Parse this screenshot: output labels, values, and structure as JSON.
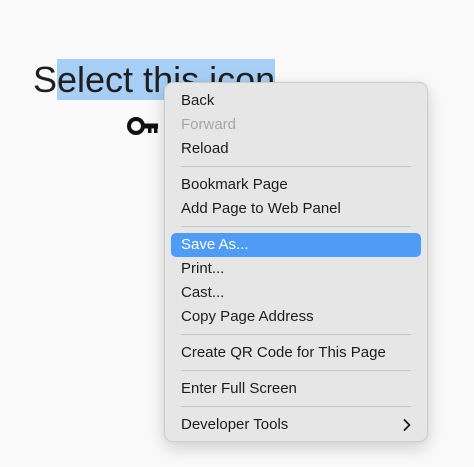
{
  "heading": {
    "before": "S",
    "selected": "elect this icon"
  },
  "icon": {
    "name": "key-icon"
  },
  "context_menu": {
    "items": [
      {
        "label": "Back",
        "enabled": true
      },
      {
        "label": "Forward",
        "enabled": false
      },
      {
        "label": "Reload",
        "enabled": true
      },
      {
        "label": "Bookmark Page",
        "enabled": true
      },
      {
        "label": "Add Page to Web Panel",
        "enabled": true
      },
      {
        "label": "Save As...",
        "enabled": true,
        "highlighted": true
      },
      {
        "label": "Print...",
        "enabled": true
      },
      {
        "label": "Cast...",
        "enabled": true
      },
      {
        "label": "Copy Page Address",
        "enabled": true
      },
      {
        "label": "Create QR Code for This Page",
        "enabled": true
      },
      {
        "label": "Enter Full Screen",
        "enabled": true
      },
      {
        "label": "Developer Tools",
        "enabled": true,
        "submenu_icon": "chevron-right-icon"
      }
    ]
  },
  "colors": {
    "selection": "#a7cff5",
    "highlight": "#4e9cf5",
    "menu_background": "#e6e6e6",
    "disabled_text": "#a6a6a6"
  }
}
